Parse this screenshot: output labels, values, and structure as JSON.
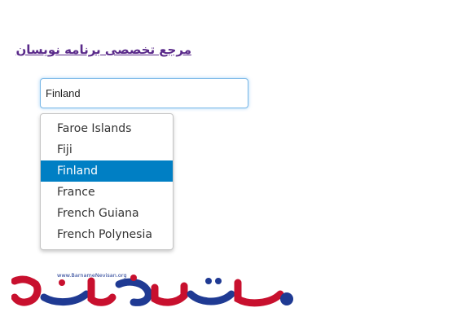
{
  "header": {
    "link_text": "مرجع تخصصی برنامه نویسان",
    "link_color": "#5a2a8a"
  },
  "autocomplete": {
    "input_value": "Finland",
    "focus_border_color": "#79b7e7",
    "highlight_color": "#007fc4",
    "options": [
      {
        "label": "Faroe Islands",
        "selected": false
      },
      {
        "label": "Fiji",
        "selected": false
      },
      {
        "label": "Finland",
        "selected": true
      },
      {
        "label": "France",
        "selected": false
      },
      {
        "label": "French Guiana",
        "selected": false
      },
      {
        "label": "French Polynesia",
        "selected": false
      }
    ]
  },
  "footer_logo": {
    "url_text": "www.BarnameNevisan.org",
    "brand_colors": [
      "#c8102e",
      "#1f3a93"
    ]
  }
}
